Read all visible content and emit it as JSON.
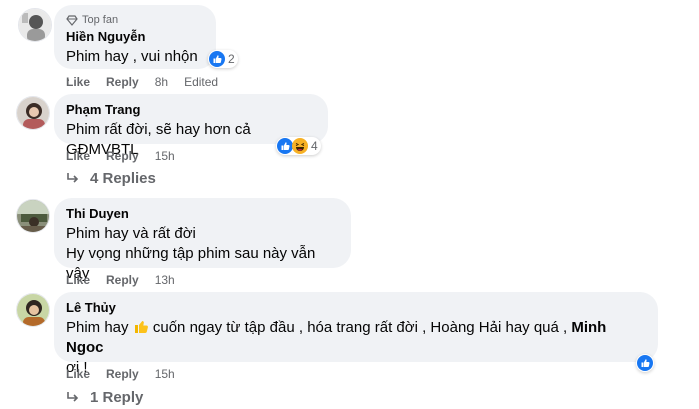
{
  "comments": [
    {
      "badge": "Top fan",
      "name": "Hiền Nguyễn",
      "text_lines": [
        "Phim hay , vui nhộn ."
      ],
      "reactions_count": "2",
      "actions": {
        "like": "Like",
        "reply": "Reply",
        "time": "8h",
        "edited": "Edited"
      }
    },
    {
      "name": "Phạm Trang",
      "text_lines": [
        "Phim rất đời, sẽ hay hơn cả GĐMVBTL"
      ],
      "reactions_count": "4",
      "actions": {
        "like": "Like",
        "reply": "Reply",
        "time": "15h"
      },
      "replies": "4 Replies"
    },
    {
      "name": "Thi Duyen",
      "text_lines": [
        "Phim hay và rất đời",
        "Hy vọng những tập phim sau này vẫn vậy"
      ],
      "actions": {
        "like": "Like",
        "reply": "Reply",
        "time": "13h"
      }
    },
    {
      "name": "Lê Thủy",
      "text_part1": "Phim hay",
      "text_part2": "cuốn ngay từ tập đầu , hóa trang rất đời , Hoàng Hải hay quá ,",
      "mention": "Minh Ngoc",
      "text_line2": "ơi !",
      "actions": {
        "like": "Like",
        "reply": "Reply",
        "time": "15h"
      },
      "replies": "1 Reply"
    }
  ]
}
